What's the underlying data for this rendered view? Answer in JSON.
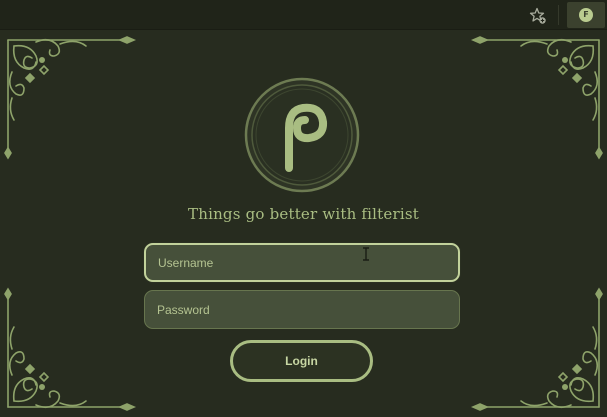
{
  "toolbar": {
    "bookmark_icon": "star-add-icon",
    "extension_icon": "filterist-icon",
    "extension_letter": "F"
  },
  "popup": {
    "logo_icon": "filterist-logo-icon",
    "tagline": "Things go better with filterist",
    "username_placeholder": "Username",
    "password_placeholder": "Password",
    "login_label": "Login"
  },
  "colors": {
    "background": "#272c1f",
    "accent": "#a9bd82",
    "field_bg": "#46503a",
    "ornament": "#8ea36a"
  }
}
